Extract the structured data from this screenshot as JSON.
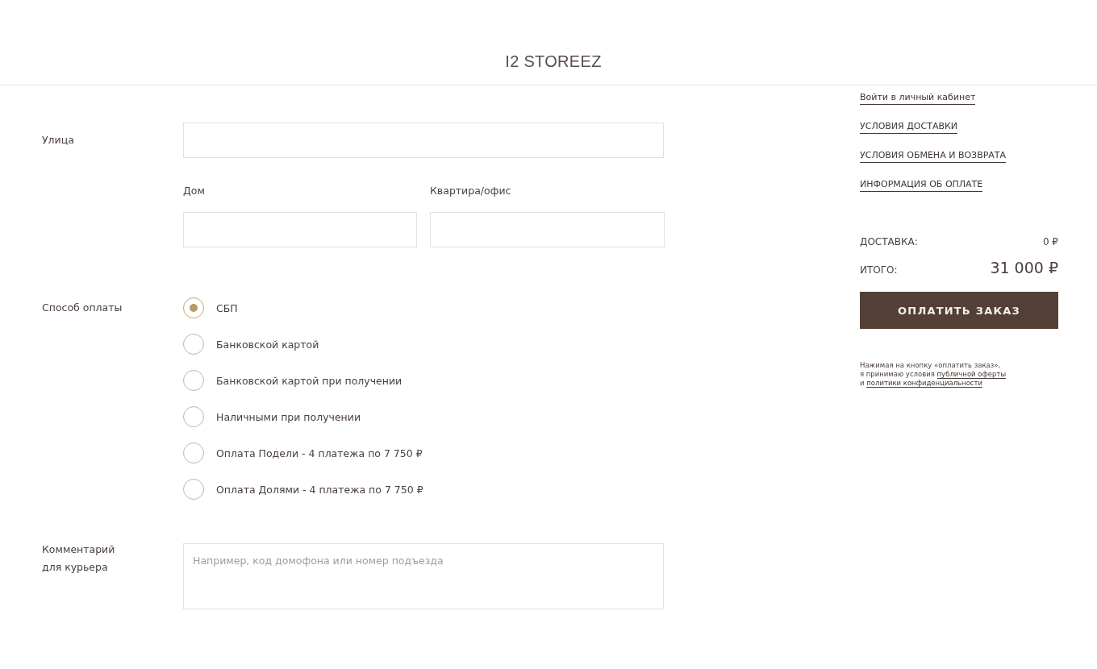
{
  "header": {
    "logo": "I2 STOREEZ"
  },
  "address": {
    "street": {
      "label": "Улица"
    },
    "house": {
      "label": "Дом"
    },
    "apartment": {
      "label": "Квартира/офис"
    }
  },
  "payment": {
    "label": "Способ оплаты",
    "options": [
      {
        "label": "СБП",
        "selected": true
      },
      {
        "label": "Банковской картой",
        "selected": false
      },
      {
        "label": "Банковской картой при получении",
        "selected": false
      },
      {
        "label": "Наличными при получении",
        "selected": false
      },
      {
        "label": "Оплата Подели - 4 платежа по 7 750 ₽",
        "selected": false
      },
      {
        "label": "Оплата Долями - 4 платежа по 7 750 ₽",
        "selected": false
      }
    ]
  },
  "comment": {
    "label": "Комментарий\nдля курьера",
    "placeholder": "Например, код домофона или номер подъезда"
  },
  "sidebar": {
    "links": [
      "Войти в личный кабинет",
      "УСЛОВИЯ ДОСТАВКИ",
      "УСЛОВИЯ ОБМЕНА И ВОЗВРАТА",
      "ИНФОРМАЦИЯ ОБ ОПЛАТЕ"
    ],
    "delivery": {
      "label": "ДОСТАВКА:",
      "value": "0 ₽"
    },
    "total": {
      "label": "ИТОГО:",
      "value": "31 000 ₽"
    },
    "pay_button": "ОПЛАТИТЬ ЗАКАЗ",
    "consent": {
      "text_before": "Нажимая на кнопку «оплатить заказ»,\nя принимаю условия ",
      "offer_link": "публичной оферты",
      "text_middle": "\nи ",
      "privacy_link": "политики конфиденциальности"
    }
  }
}
